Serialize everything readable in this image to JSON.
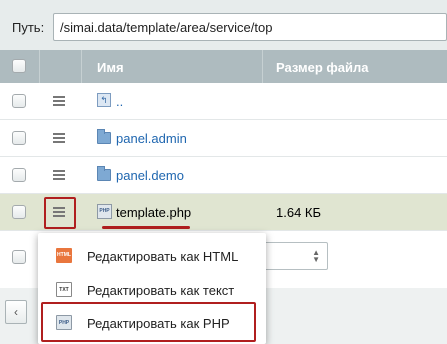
{
  "path": {
    "label": "Путь:",
    "value": "/simai.data/template/area/service/top"
  },
  "table": {
    "headers": {
      "name": "Имя",
      "size": "Размер файла"
    },
    "rows": [
      {
        "name": "..",
        "type": "up",
        "size": ""
      },
      {
        "name": "panel.admin",
        "type": "folder",
        "size": ""
      },
      {
        "name": "panel.demo",
        "type": "folder",
        "size": ""
      },
      {
        "name": "template.php",
        "type": "php",
        "size": "1.64 КБ",
        "selected": true
      }
    ]
  },
  "context_menu": {
    "items": [
      {
        "label": "Редактировать как HTML",
        "icon": "html-file-icon",
        "badge": "HTML"
      },
      {
        "label": "Редактировать как текст",
        "icon": "txt-file-icon",
        "badge": "TXT"
      },
      {
        "label": "Редактировать как PHP",
        "icon": "php-file-icon",
        "badge": "PHP",
        "highlighted": true
      }
    ]
  },
  "pager": {
    "prev": "‹"
  },
  "select": {
    "arrow_up": "▲",
    "arrow_down": "▼"
  },
  "colors": {
    "highlight": "#b01f1f",
    "header_bg": "#aebbbf",
    "selected_row": "#e0e5d1",
    "link": "#2067b0"
  },
  "php_badge": "PHP"
}
